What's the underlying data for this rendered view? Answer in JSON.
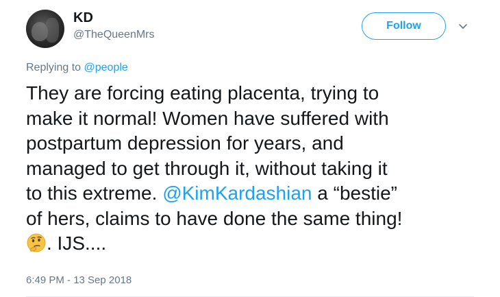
{
  "user": {
    "display_name": "KD",
    "handle": "@TheQueenMrs"
  },
  "follow_button": {
    "label": "Follow"
  },
  "reply": {
    "prefix": "Replying to ",
    "mention": "@people"
  },
  "tweet": {
    "line1": "They are forcing eating placenta, trying to",
    "line2": "make it normal! Women have suffered with",
    "line3": "postpartum depression for years, and",
    "line4": "managed to get through it, without taking it",
    "line5_before": "to this extreme.  ",
    "mention": "@KimKardashian",
    "line5_after": " a “bestie”",
    "line6": "of hers, claims to have done the same thing!",
    "line7_after_emoji": ". IJS....",
    "emoji": "thinking-face-emoji"
  },
  "timestamp": "6:49 PM - 13 Sep 2018",
  "colors": {
    "accent": "#1da1f2",
    "secondary_text": "#657786",
    "primary_text": "#14171a"
  }
}
